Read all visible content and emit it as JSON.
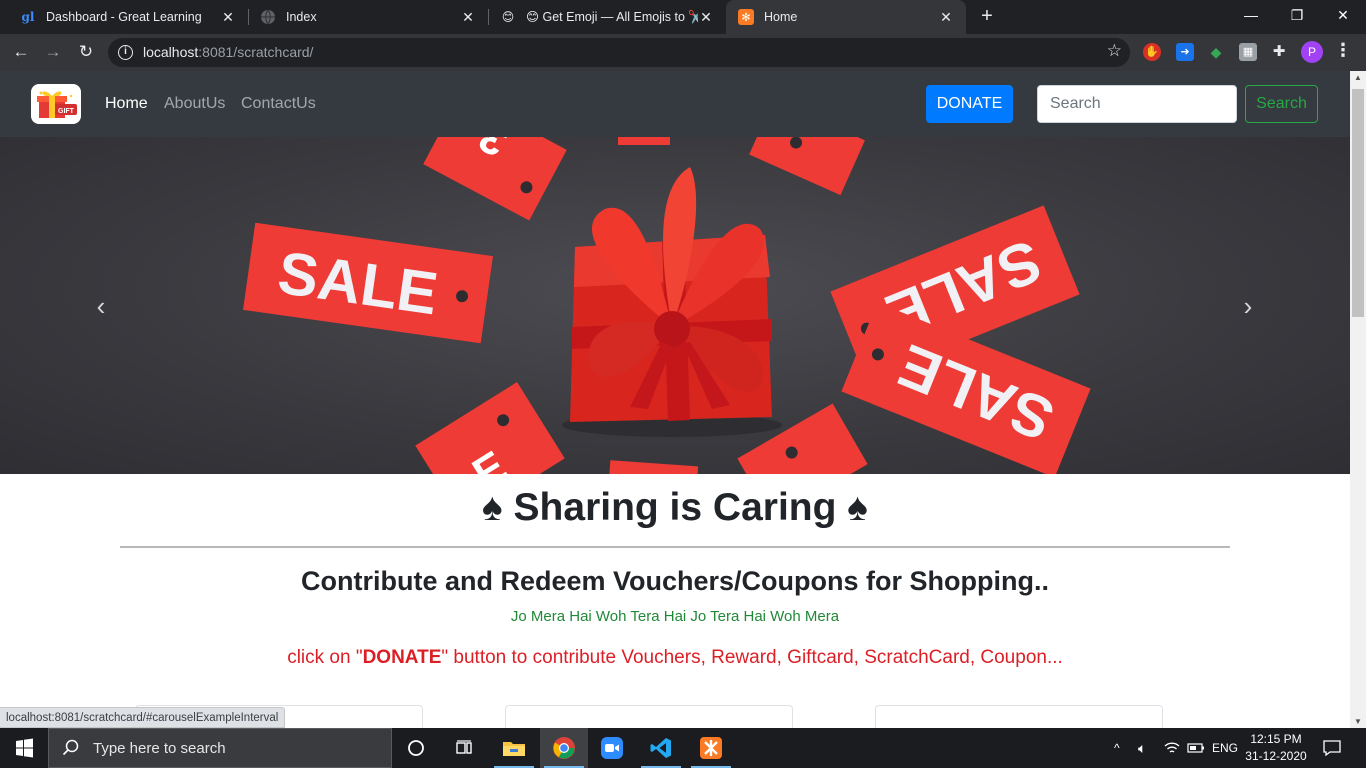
{
  "browser": {
    "tabs": [
      {
        "title": "Dashboard - Great Learning",
        "icon": "great-learning-icon",
        "active": false
      },
      {
        "title": "Index",
        "icon": "globe-icon",
        "active": false
      },
      {
        "title": "😊 Get Emoji — All Emojis to ✂️",
        "icon": "emoji-icon",
        "active": false
      },
      {
        "title": "Home",
        "icon": "xampp-icon",
        "active": true
      }
    ],
    "url_host": "localhost",
    "url_rest": ":8081/scratchcard/",
    "profile_initial": "P"
  },
  "navbar": {
    "links": [
      {
        "label": "Home",
        "active": true
      },
      {
        "label": "AboutUs",
        "active": false
      },
      {
        "label": "ContactUs",
        "active": false
      }
    ],
    "donate_label": "DONATE",
    "search_placeholder": "Search",
    "search_button": "Search"
  },
  "carousel": {
    "tag_text": "SALE"
  },
  "content": {
    "heading": "♠ Sharing is Caring ♠",
    "subheading": "Contribute and Redeem Vouchers/Coupons for Shopping..",
    "tagline": "Jo Mera Hai Woh Tera Hai Jo Tera Hai Woh Mera",
    "cta_prefix": "click on \"",
    "cta_bold": "DONATE",
    "cta_suffix": "\" button to contribute Vouchers, Reward, Giftcard, ScratchCard, Coupon..."
  },
  "status_bar": "localhost:8081/scratchcard/#carouselExampleInterval",
  "taskbar": {
    "search_placeholder": "Type here to search",
    "language": "ENG",
    "time": "12:15 PM",
    "date": "31-12-2020"
  },
  "colors": {
    "navbar_bg": "#343a40",
    "donate_blue": "#007bff",
    "search_green": "#28a745",
    "cta_red": "#dc1f26",
    "sale_tag_red": "#ef3b36"
  }
}
